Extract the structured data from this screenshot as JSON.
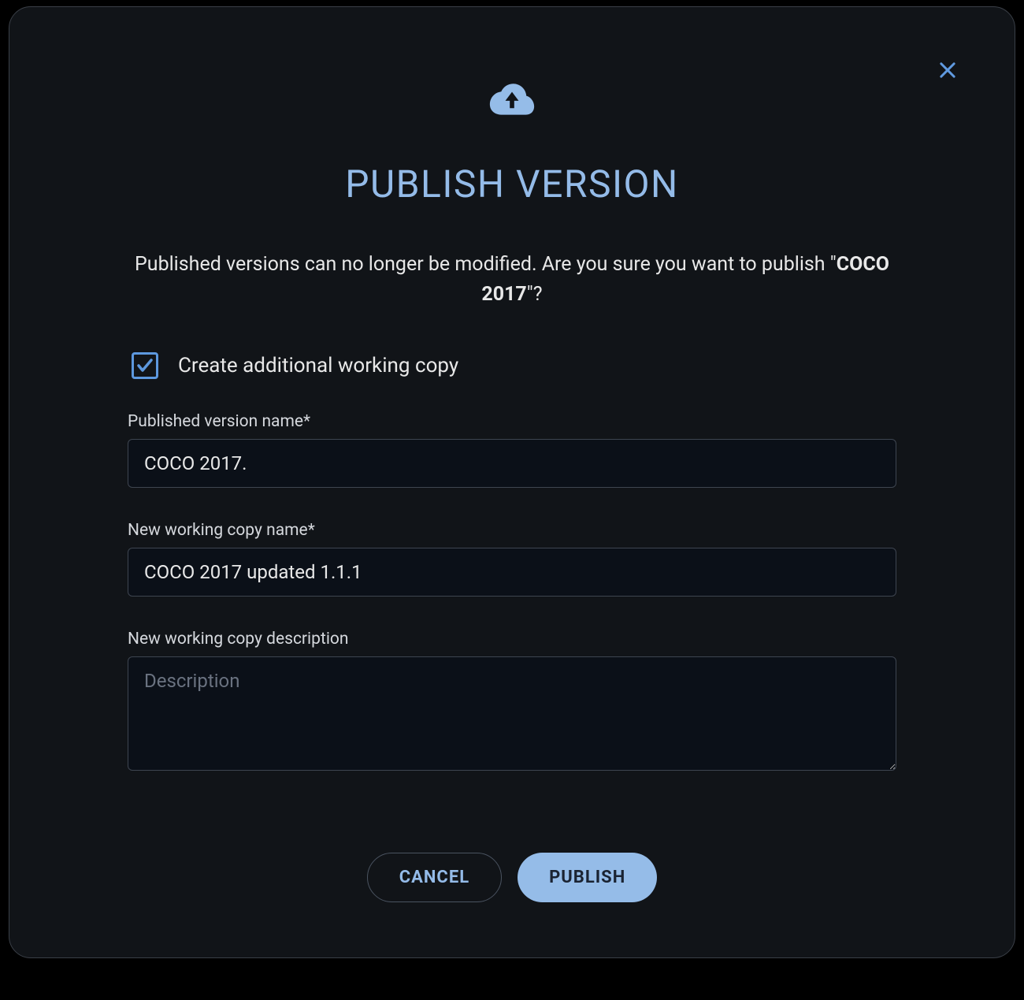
{
  "modal": {
    "title": "PUBLISH VERSION",
    "description_prefix": "Published versions can no longer be modified. Are you sure you want to publish \"",
    "description_bold": "COCO 2017",
    "description_suffix": "\"?",
    "checkbox": {
      "label": "Create additional working copy",
      "checked": true
    },
    "fields": {
      "published_name": {
        "label": "Published version name*",
        "value": "COCO 2017."
      },
      "working_copy_name": {
        "label": "New working copy name*",
        "value": "COCO 2017 updated 1.1.1"
      },
      "working_copy_description": {
        "label": "New working copy description",
        "placeholder": "Description",
        "value": ""
      }
    },
    "buttons": {
      "cancel": "CANCEL",
      "publish": "PUBLISH"
    }
  }
}
